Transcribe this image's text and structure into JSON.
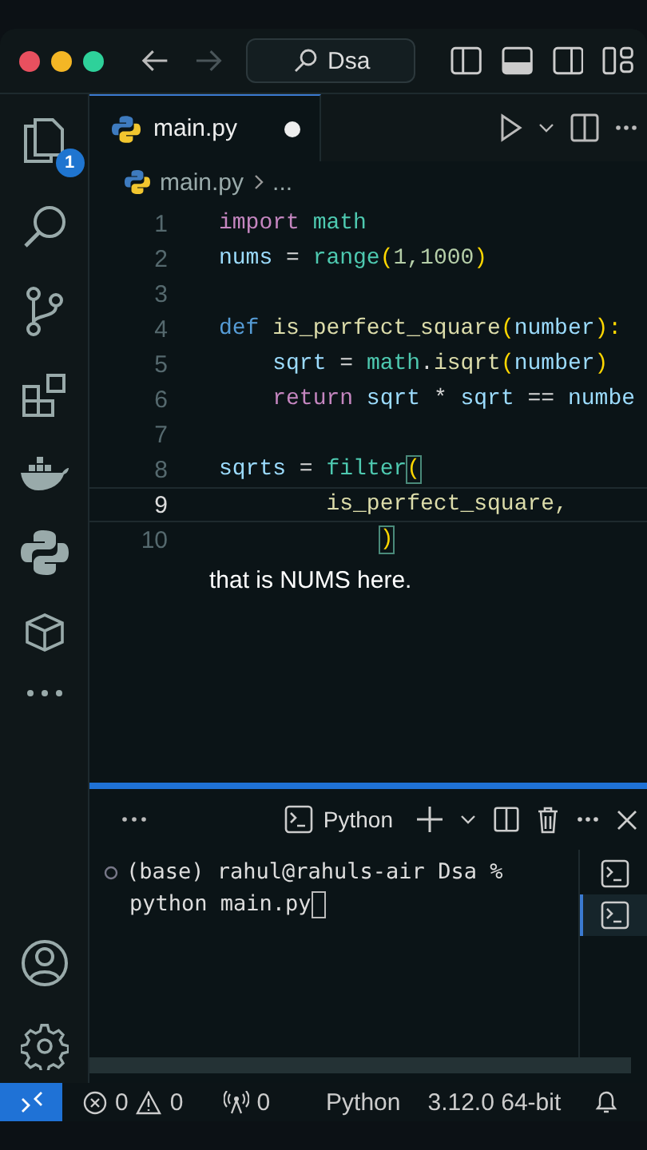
{
  "title_bar": {
    "search": "Dsa",
    "back_disabled": false,
    "forward_disabled": true
  },
  "activity_bar": {
    "explorer_badge": "1"
  },
  "tab": {
    "label": "main.py",
    "dirty": true,
    "selected": true
  },
  "breadcrumb": {
    "file": "main.py",
    "more": "..."
  },
  "code_lines": [
    {
      "number": "1",
      "active": false,
      "tokens": [
        {
          "text": "import ",
          "kind": "keyword"
        },
        {
          "text": "math",
          "kind": "module"
        }
      ]
    },
    {
      "number": "2",
      "active": false,
      "tokens": [
        {
          "text": "nums",
          "kind": "var"
        },
        {
          "text": " = ",
          "kind": "plain"
        },
        {
          "text": "range",
          "kind": "module"
        },
        {
          "text": "(",
          "kind": "bracket"
        },
        {
          "text": "1,1000",
          "kind": "num"
        },
        {
          "text": ")",
          "kind": "bracket"
        }
      ]
    },
    {
      "number": "3",
      "active": false
    },
    {
      "number": "4",
      "active": false,
      "tokens": [
        {
          "text": "def ",
          "kind": "def"
        },
        {
          "text": "is_perfect_square",
          "kind": "func"
        },
        {
          "text": "(",
          "kind": "bracket"
        },
        {
          "text": "number",
          "kind": "var"
        },
        {
          "text": "):",
          "kind": "bracket"
        }
      ]
    },
    {
      "number": "5",
      "active": false,
      "tokens": [
        {
          "text": "    sqrt",
          "kind": "var"
        },
        {
          "text": " = ",
          "kind": "plain"
        },
        {
          "text": "math",
          "kind": "module"
        },
        {
          "text": ".",
          "kind": "plain"
        },
        {
          "text": "isqrt",
          "kind": "func"
        },
        {
          "text": "(",
          "kind": "bracket"
        },
        {
          "text": "number",
          "kind": "var"
        },
        {
          "text": ")",
          "kind": "bracket"
        }
      ]
    },
    {
      "number": "6",
      "active": false,
      "tokens": [
        {
          "text": "    return ",
          "kind": "keyword"
        },
        {
          "text": "sqrt",
          "kind": "var"
        },
        {
          "text": " * ",
          "kind": "plain"
        },
        {
          "text": "sqrt",
          "kind": "var"
        },
        {
          "text": " == ",
          "kind": "plain"
        },
        {
          "text": "numbe",
          "kind": "var"
        }
      ]
    },
    {
      "number": "7",
      "active": false
    },
    {
      "number": "8",
      "active": false,
      "tokens": [
        {
          "text": "sqrts",
          "kind": "var"
        },
        {
          "text": " = ",
          "kind": "plain"
        },
        {
          "text": "filter",
          "kind": "module"
        },
        {
          "text": "(",
          "kind": "match"
        }
      ]
    },
    {
      "number": "9",
      "active": true,
      "tokens": [
        {
          "text": "        is_perfect_square,",
          "kind": "func"
        }
      ]
    },
    {
      "number": "10",
      "active": false,
      "tokens": [
        {
          "text": "            )",
          "kind": "match"
        }
      ]
    }
  ],
  "caption": "that is NUMS here.",
  "terminal": {
    "tab_label": "Python",
    "lines": [
      "(base) rahul@rahuls-air Dsa %",
      "python main.py"
    ],
    "instances": [
      {
        "selected": false
      },
      {
        "selected": true
      }
    ]
  },
  "status_bar": {
    "errors": "0",
    "warnings": "0",
    "ports": "0",
    "language": "Python",
    "interpreter": "3.12.0 64-bit"
  }
}
